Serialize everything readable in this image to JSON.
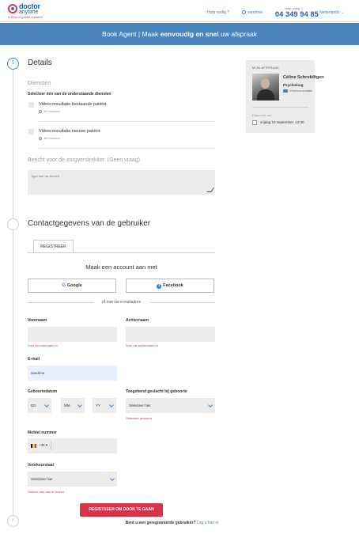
{
  "header": {
    "logo_line1": "doctor",
    "logo_line2": "anytime",
    "logo_tagline": "U bent in goede handen!",
    "help": "Hulp nodig ?",
    "user": "sandrine",
    "phone_label": "Hulp nodig ?",
    "phone": "04 349 94 85",
    "language": "Nederlands"
  },
  "banner": {
    "prefix": "Book Agent | Maak ",
    "emphasis": "eenvoudig en snel",
    "suffix": " uw afspraak"
  },
  "steps": {
    "step1": "1"
  },
  "details": {
    "title": "Details",
    "services_title": "Diensten",
    "services_prompt": "Selecteer één van de onderstaande diensten",
    "services": [
      {
        "name": "Videoconsultatie bestaande patiënt",
        "duration": "60 minuten"
      },
      {
        "name": "Videoconsultatie nieuwe patiënt",
        "duration": "60 minuten"
      }
    ],
    "message_title": "Bericht voor de zorgverstrekker. (Geen vraag)",
    "message_placeholder": "Type hier uw bericht"
  },
  "contact": {
    "title": "Contactgegevens van de gebruiker",
    "tab_register": "REGISTREER",
    "account_title": "Maak een account aan met",
    "google": "Google",
    "facebook": "Facebook",
    "or_email": "of met uw e-mailadres",
    "first_name": {
      "label": "Voornaam",
      "error": "Voer uw voornaam in",
      "value": ""
    },
    "last_name": {
      "label": "Achternaam",
      "error": "Voer uw achternaam in",
      "value": ""
    },
    "email": {
      "label": "E-mail",
      "value": "sandrine"
    },
    "birthdate": {
      "label": "Geboortedatum",
      "day": "DD",
      "month": "MM",
      "year": "YY"
    },
    "gender": {
      "label": "Toegekend geslacht bij geboorte",
      "value": "Selecteer hier",
      "error": "Selecteer geslacht"
    },
    "mobile": {
      "label": "Mobiel nummer",
      "country_code": "+32",
      "value": ""
    },
    "language_pref": {
      "label": "Voorkeurstaal",
      "value": "Selecteer hier",
      "error": "Gelieve een taal te kiezen"
    },
    "submit": "REGISTREER OM DOOR TE GAAN",
    "login_question": "Bent u een geregistreerde gebruiker?",
    "login_link": "Log u hier in"
  },
  "appointment": {
    "title": "MIJN AFSPRAAK",
    "doctor_name": "Céline Schrobiltgen",
    "specialty": "Psycholoog",
    "mode": "Videoconsultatie",
    "date_label": "Datum en uur",
    "date_value": "vrijdag 10 september, 13:30"
  },
  "colors": {
    "primary": "#4a84bd",
    "accent": "#d8334a",
    "brand": "#1f5aa6"
  }
}
